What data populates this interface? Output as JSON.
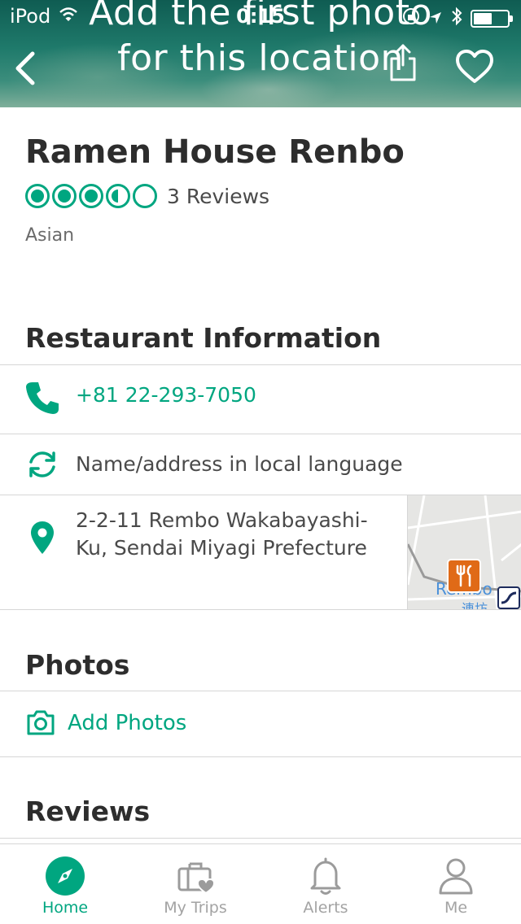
{
  "status_bar": {
    "carrier": "iPod",
    "time": "0:15"
  },
  "hero": {
    "line1": "Add the first photo",
    "line2": "for this location"
  },
  "restaurant": {
    "name": "Ramen House Renbo",
    "rating": 3.5,
    "reviews_count": "3 Reviews",
    "cuisine": "Asian"
  },
  "info": {
    "title": "Restaurant Information",
    "phone": "+81 22-293-7050",
    "local_language": "Name/address in local language",
    "address": "2-2-11 Rembo Wakabayashi-Ku, Sendai Miyagi Prefecture",
    "map_label": "Rembo",
    "map_label_local": "連坊"
  },
  "photos": {
    "title": "Photos",
    "add_label": "Add Photos"
  },
  "reviews": {
    "title": "Reviews"
  },
  "tabbar": {
    "items": [
      {
        "label": "Home",
        "icon": "compass-icon",
        "active": true
      },
      {
        "label": "My Trips",
        "icon": "suitcase-heart-icon",
        "active": false
      },
      {
        "label": "Alerts",
        "icon": "bell-icon",
        "active": false
      },
      {
        "label": "Me",
        "icon": "person-icon",
        "active": false
      }
    ]
  },
  "colors": {
    "accent": "#00a680",
    "text": "#2d2d2d",
    "muted": "#a3a3a3"
  }
}
